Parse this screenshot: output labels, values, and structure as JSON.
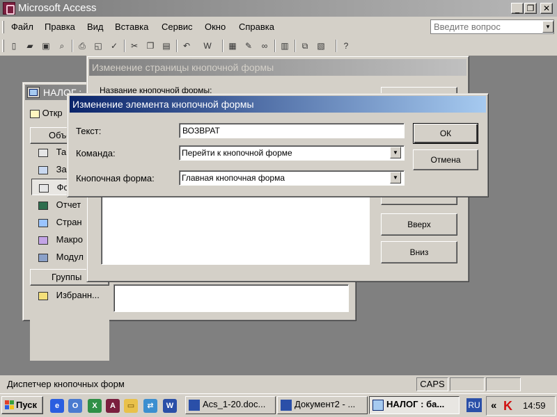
{
  "app": {
    "title": "Microsoft Access"
  },
  "window_controls": {
    "minimize": "_",
    "restore": "❐",
    "close": "✕"
  },
  "menu": {
    "items": [
      {
        "label": "Файл",
        "name": "file"
      },
      {
        "label": "Правка",
        "name": "edit"
      },
      {
        "label": "Вид",
        "name": "view"
      },
      {
        "label": "Вставка",
        "name": "insert"
      },
      {
        "label": "Сервис",
        "name": "tools"
      },
      {
        "label": "Окно",
        "name": "window"
      },
      {
        "label": "Справка",
        "name": "help"
      }
    ],
    "ask_placeholder": "Введите вопрос"
  },
  "toolbar": {
    "icons": [
      "new-icon",
      "open-icon",
      "save-icon",
      "file-search-icon",
      "print-icon",
      "print-preview-icon",
      "spelling-icon",
      "cut-icon",
      "copy-icon",
      "paste-icon",
      "undo-icon",
      "office-links-icon",
      "analyze-icon",
      "code-icon",
      "script-icon",
      "properties-icon",
      "relationships-icon",
      "new-object-icon",
      "help-icon"
    ]
  },
  "db_window": {
    "title": "НАЛОГ :",
    "open_label": "Откр",
    "objects_header": "Объе",
    "objects": [
      {
        "label": "Та",
        "icon": "table-icon"
      },
      {
        "label": "За",
        "icon": "query-icon"
      },
      {
        "label": "Фо",
        "icon": "form-icon"
      },
      {
        "label": "Отчет",
        "icon": "report-icon"
      },
      {
        "label": "Стран",
        "icon": "page-icon"
      },
      {
        "label": "Макро",
        "icon": "macro-icon"
      },
      {
        "label": "Модул",
        "icon": "module-icon"
      }
    ],
    "groups_header": "Группы",
    "favorites": "Избранн..."
  },
  "page_dialog": {
    "title": "Изменение страницы кнопочной формы",
    "name_label": "Название кнопочной формы:",
    "up_button": "Вверх",
    "down_button": "Вниз"
  },
  "item_dialog": {
    "title": "Изменение элемента кнопочной формы",
    "text_label": "Текст:",
    "text_value": "ВОЗВРАТ",
    "command_label": "Команда:",
    "command_value": "Перейти к кнопочной форме",
    "form_label": "Кнопочная форма:",
    "form_value": "Главная кнопочная форма",
    "ok_button": "ОК",
    "cancel_button": "Отмена"
  },
  "status": {
    "text": "Диспетчер кнопочных форм",
    "caps": "CAPS"
  },
  "taskbar": {
    "start": "Пуск",
    "tasks": [
      {
        "label": "Acs_1-20.doc...",
        "icon": "word-doc-icon"
      },
      {
        "label": "Документ2 - ...",
        "icon": "word-doc-icon"
      },
      {
        "label": "НАЛОГ : ба...",
        "icon": "access-db-icon"
      }
    ],
    "lang": "RU",
    "tray_arrow": "«",
    "time": "14:59"
  },
  "colors": {
    "active_caption": "#0a246a",
    "inactive_caption": "#808080",
    "face": "#d4d0c8",
    "desktop_mdi": "#808080"
  }
}
